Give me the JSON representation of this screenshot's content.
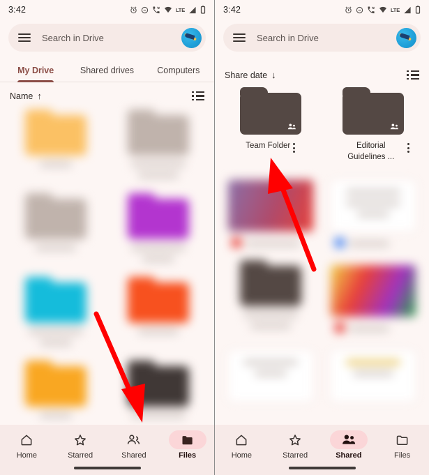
{
  "status_bar": {
    "time": "3:42",
    "icons": [
      "alarm-icon",
      "do-not-disturb-icon",
      "missed-call-icon",
      "wifi-icon",
      "lte-label",
      "signal-icon",
      "battery-icon"
    ],
    "network_label": "LTE"
  },
  "colors": {
    "background": "#FDF6F4",
    "search_bar": "#F6EAE7",
    "accent": "#8B4D46",
    "nav_bar": "#F7EAE8",
    "nav_pill": "#FBD6D8",
    "shared_folder": "#544844",
    "arrow": "#FF0000"
  },
  "left_screen": {
    "search": {
      "placeholder": "Search in Drive",
      "menu_icon": "hamburger-icon",
      "avatar_icon": "account-avatar"
    },
    "tabs": [
      {
        "label": "My Drive",
        "active": true
      },
      {
        "label": "Shared drives",
        "active": false
      },
      {
        "label": "Computers",
        "active": false
      }
    ],
    "sort": {
      "label": "Name",
      "direction_glyph": "↑",
      "view_toggle_icon": "list-view-icon"
    },
    "items": [
      {
        "name": "",
        "kind": "folder",
        "color": "#FBC164",
        "blurred": true
      },
      {
        "name": "",
        "kind": "folder",
        "color": "#C0B3AC",
        "blurred": true
      },
      {
        "name": "",
        "kind": "folder",
        "color": "#C0B3AC",
        "blurred": true
      },
      {
        "name": "",
        "kind": "folder",
        "color": "#B335CF",
        "blurred": true
      },
      {
        "name": "",
        "kind": "folder",
        "color": "#15BCDB",
        "blurred": true
      },
      {
        "name": "",
        "kind": "folder",
        "color": "#F7511F",
        "blurred": true
      },
      {
        "name": "",
        "kind": "folder",
        "color": "#F9A722",
        "blurred": true
      },
      {
        "name": "",
        "kind": "folder",
        "color": "#403836",
        "blurred": true
      }
    ],
    "bottom_nav": [
      {
        "label": "Home",
        "icon": "home-icon",
        "active": false
      },
      {
        "label": "Starred",
        "icon": "star-icon",
        "active": false
      },
      {
        "label": "Shared",
        "icon": "people-icon",
        "active": false
      },
      {
        "label": "Files",
        "icon": "folder-icon",
        "active": true
      }
    ],
    "annotation": {
      "type": "arrow",
      "points_to": "Shared"
    }
  },
  "right_screen": {
    "search": {
      "placeholder": "Search in Drive",
      "menu_icon": "hamburger-icon",
      "avatar_icon": "account-avatar"
    },
    "sort": {
      "label": "Share date",
      "direction_glyph": "↓",
      "view_toggle_icon": "list-view-icon"
    },
    "items": [
      {
        "name": "Team Folder",
        "kind": "shared-folder",
        "color": "#544844",
        "badge": "people-badge",
        "blurred": false,
        "menu_icon": "kebab-menu-icon"
      },
      {
        "name": "Editorial Guidelines ...",
        "kind": "shared-folder",
        "color": "#544844",
        "badge": "people-badge",
        "blurred": false,
        "menu_icon": "kebab-menu-icon"
      },
      {
        "name": "",
        "kind": "image",
        "color": "#B04A6A",
        "blurred": true
      },
      {
        "name": "",
        "kind": "document",
        "color": "#4285F4",
        "blurred": true
      },
      {
        "name": "",
        "kind": "shared-folder",
        "color": "#544844",
        "blurred": true
      },
      {
        "name": "",
        "kind": "image",
        "color": "#E8413A",
        "blurred": true
      },
      {
        "name": "",
        "kind": "document",
        "color": "#D8D2CE",
        "blurred": true
      },
      {
        "name": "",
        "kind": "document",
        "color": "#E8C35A",
        "blurred": true
      }
    ],
    "bottom_nav": [
      {
        "label": "Home",
        "icon": "home-icon",
        "active": false
      },
      {
        "label": "Starred",
        "icon": "star-icon",
        "active": false
      },
      {
        "label": "Shared",
        "icon": "people-icon",
        "active": true
      },
      {
        "label": "Files",
        "icon": "folder-icon",
        "active": false
      }
    ],
    "annotation": {
      "type": "arrow",
      "points_to": "Team Folder"
    }
  }
}
